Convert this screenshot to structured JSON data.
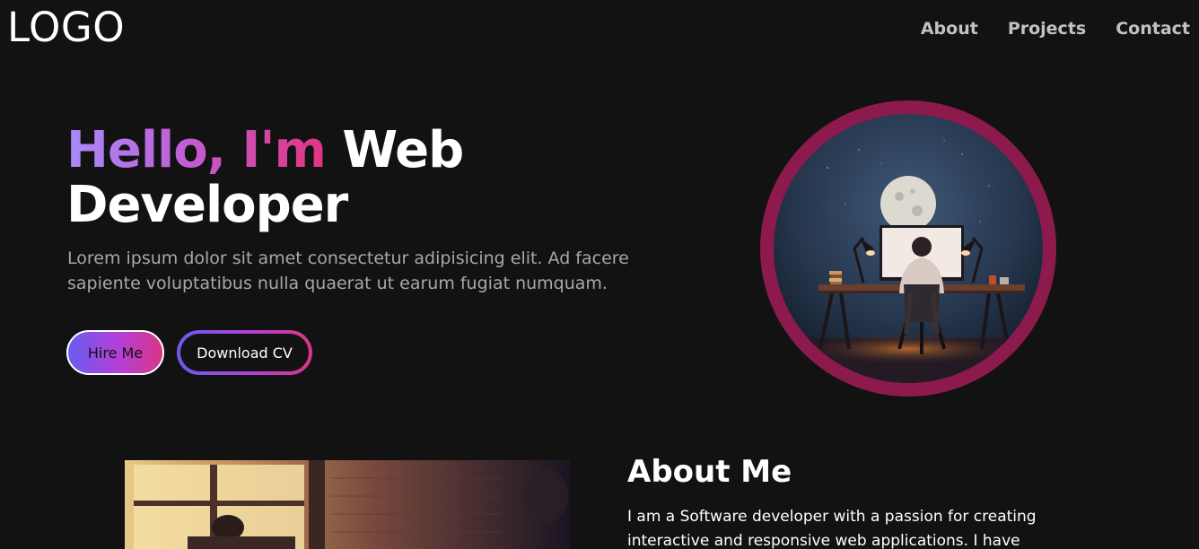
{
  "header": {
    "logo": "LOGO",
    "nav": [
      "About",
      "Projects",
      "Contact"
    ]
  },
  "hero": {
    "greeting": "Hello, I'm",
    "title_rest": "Web",
    "title_line2": "Developer",
    "description": "Lorem ipsum dolor sit amet consectetur adipisicing elit. Ad facere sapiente voluptatibus nulla quaerat ut earum fugiat numquam.",
    "hire_button": "Hire Me",
    "cv_button": "Download CV",
    "image_icon": "developer-desk-illustration"
  },
  "about": {
    "title": "About Me",
    "text": "I am a Software developer with a passion for creating interactive and responsive web applications. I have"
  },
  "colors": {
    "background": "#121212",
    "accent_purple": "#a78bfa",
    "accent_pink": "#e1357f",
    "ring": "#8c1a4c",
    "muted_text": "#a8a8a8"
  }
}
